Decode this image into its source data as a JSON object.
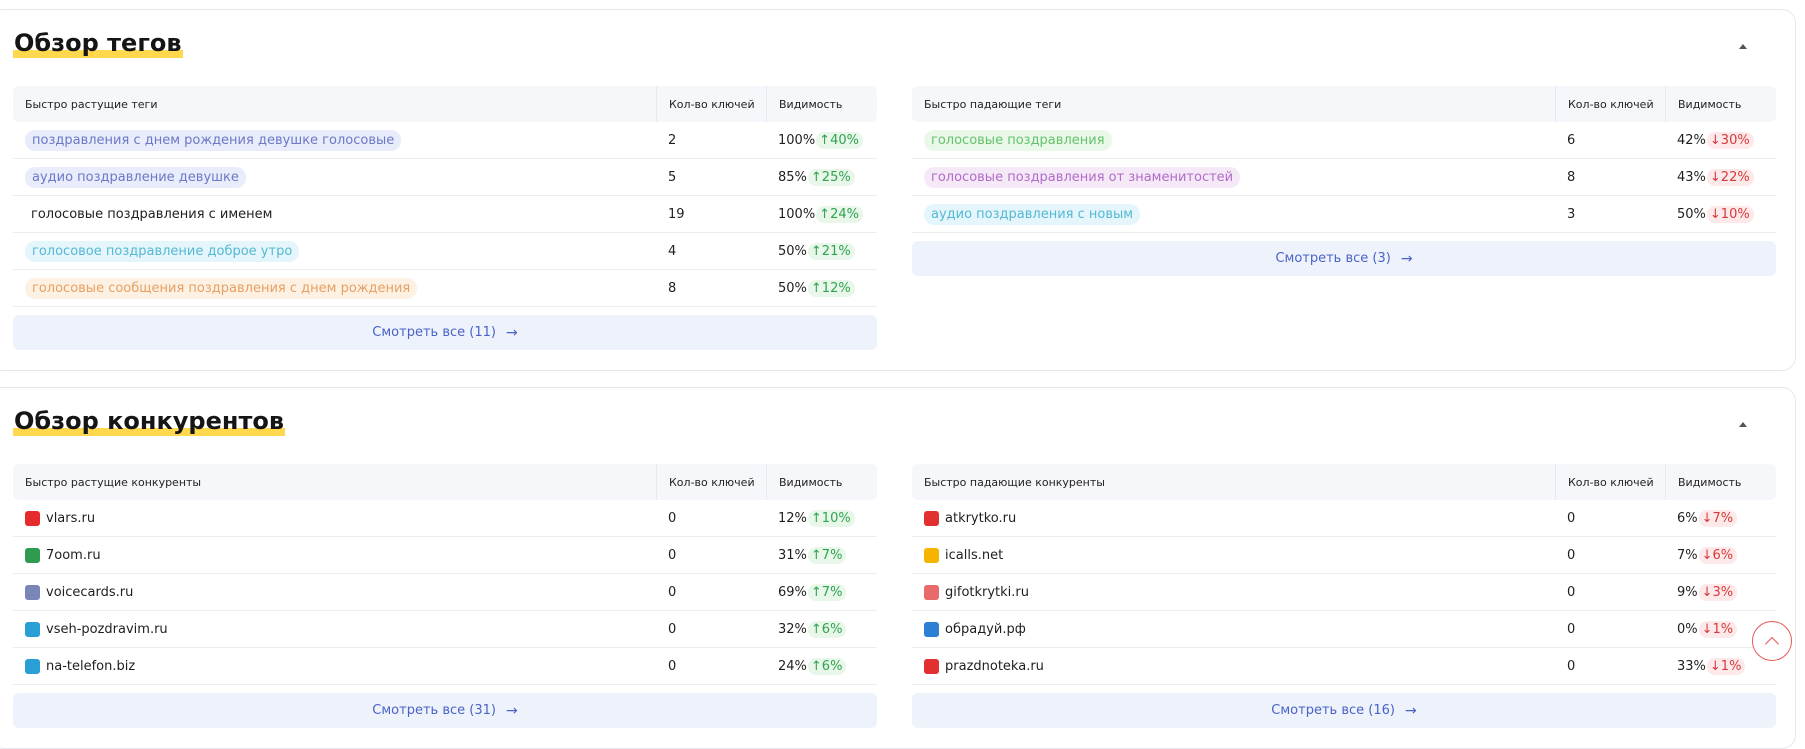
{
  "tags": {
    "title": "Обзор тегов",
    "growing": {
      "header": {
        "name": "Быстро растущие теги",
        "keys": "Кол-во ключей",
        "vis": "Видимость"
      },
      "rows": [
        {
          "name": "поздравления с днем рождения девушке голосовые",
          "keys": "2",
          "vis": "100%",
          "delta": "↑40%",
          "bg": "#e9ecfb",
          "fg": "#6b79c6"
        },
        {
          "name": "аудио поздравление девушке",
          "keys": "5",
          "vis": "85%",
          "delta": "↑25%",
          "bg": "#e9ecfb",
          "fg": "#6b79c6"
        },
        {
          "name": "голосовые поздравления с именем",
          "keys": "19",
          "vis": "100%",
          "delta": "↑24%",
          "bg": "transparent",
          "fg": "#1f1f1f"
        },
        {
          "name": "голосовое поздравление доброе утро",
          "keys": "4",
          "vis": "50%",
          "delta": "↑21%",
          "bg": "#e4f6fb",
          "fg": "#55b8d3"
        },
        {
          "name": "голосовые сообщения поздравления с днем рождения",
          "keys": "8",
          "vis": "50%",
          "delta": "↑12%",
          "bg": "#fdf1e4",
          "fg": "#e8a062"
        }
      ],
      "see_all": "Смотреть все (11)"
    },
    "falling": {
      "header": {
        "name": "Быстро падающие теги",
        "keys": "Кол-во ключей",
        "vis": "Видимость"
      },
      "rows": [
        {
          "name": "голосовые поздравления",
          "keys": "6",
          "vis": "42%",
          "delta": "↓30%",
          "bg": "#eaf8ea",
          "fg": "#63c26a"
        },
        {
          "name": "голосовые поздравления от знаменитостей",
          "keys": "8",
          "vis": "43%",
          "delta": "↓22%",
          "bg": "#f5e9f8",
          "fg": "#b06cc8"
        },
        {
          "name": "аудио поздравления с новым",
          "keys": "3",
          "vis": "50%",
          "delta": "↓10%",
          "bg": "#e4f6fb",
          "fg": "#55b8d3"
        }
      ],
      "see_all": "Смотреть все (3)"
    }
  },
  "competitors": {
    "title": "Обзор конкурентов",
    "growing": {
      "header": {
        "name": "Быстро растущие конкуренты",
        "keys": "Кол-во ключей",
        "vis": "Видимость"
      },
      "rows": [
        {
          "name": "vlars.ru",
          "keys": "0",
          "vis": "12%",
          "delta": "↑10%",
          "icon": "vlars-favicon",
          "color": "#e52b2b"
        },
        {
          "name": "7oom.ru",
          "keys": "0",
          "vis": "31%",
          "delta": "↑7%",
          "icon": "7oom-favicon",
          "color": "#2e9b4e"
        },
        {
          "name": "voicecards.ru",
          "keys": "0",
          "vis": "69%",
          "delta": "↑7%",
          "icon": "voicecards-favicon",
          "color": "#7a86b8"
        },
        {
          "name": "vseh-pozdravim.ru",
          "keys": "0",
          "vis": "32%",
          "delta": "↑6%",
          "icon": "vseh-pozdravim-favicon",
          "color": "#2a9fd6"
        },
        {
          "name": "na-telefon.biz",
          "keys": "0",
          "vis": "24%",
          "delta": "↑6%",
          "icon": "na-telefon-favicon",
          "color": "#2a9fd6"
        }
      ],
      "see_all": "Смотреть все (31)"
    },
    "falling": {
      "header": {
        "name": "Быстро падающие конкуренты",
        "keys": "Кол-во ключей",
        "vis": "Видимость"
      },
      "rows": [
        {
          "name": "atkrytko.ru",
          "keys": "0",
          "vis": "6%",
          "delta": "↓7%",
          "icon": "atkrytko-favicon",
          "color": "#e23030"
        },
        {
          "name": "icalls.net",
          "keys": "0",
          "vis": "7%",
          "delta": "↓6%",
          "icon": "icalls-favicon",
          "color": "#f4b400"
        },
        {
          "name": "gifotkrytki.ru",
          "keys": "0",
          "vis": "9%",
          "delta": "↓3%",
          "icon": "gifotkrytki-favicon",
          "color": "#e86a6a"
        },
        {
          "name": "обрадуй.рф",
          "keys": "0",
          "vis": "0%",
          "delta": "↓1%",
          "icon": "obraduy-favicon",
          "color": "#2b7fd4"
        },
        {
          "name": "prazdnoteka.ru",
          "keys": "0",
          "vis": "33%",
          "delta": "↓1%",
          "icon": "prazdnoteka-favicon",
          "color": "#e23030"
        }
      ],
      "see_all": "Смотреть все (16)"
    }
  },
  "arrow": "→"
}
